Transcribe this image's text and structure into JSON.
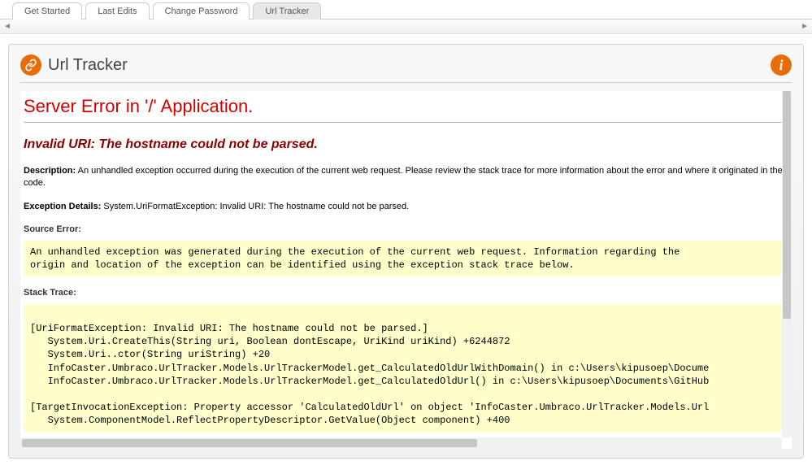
{
  "tabs": {
    "items": [
      {
        "label": "Get Started",
        "active": false
      },
      {
        "label": "Last Edits",
        "active": false
      },
      {
        "label": "Change Password",
        "active": false
      },
      {
        "label": "Url Tracker",
        "active": true
      }
    ]
  },
  "panel": {
    "title": "Url Tracker",
    "icon": "link-icon",
    "info_icon": "info-icon"
  },
  "error": {
    "title": "Server Error in '/' Application.",
    "subtitle": "Invalid URI: The hostname could not be parsed.",
    "description_label": "Description:",
    "description_text": " An unhandled exception occurred during the execution of the current web request. Please review the stack trace for more information about the error and where it originated in the code.",
    "details_label": "Exception Details:",
    "details_text": " System.UriFormatException: Invalid URI: The hostname could not be parsed.",
    "source_error_label": "Source Error:",
    "source_error_block": "An unhandled exception was generated during the execution of the current web request. Information regarding the\norigin and location of the exception can be identified using the exception stack trace below.",
    "stack_trace_label": "Stack Trace:",
    "stack_trace_block": "\n[UriFormatException: Invalid URI: The hostname could not be parsed.]\n   System.Uri.CreateThis(String uri, Boolean dontEscape, UriKind uriKind) +6244872\n   System.Uri..ctor(String uriString) +20\n   InfoCaster.Umbraco.UrlTracker.Models.UrlTrackerModel.get_CalculatedOldUrlWithDomain() in c:\\Users\\kipusoep\\Docume\n   InfoCaster.Umbraco.UrlTracker.Models.UrlTrackerModel.get_CalculatedOldUrl() in c:\\Users\\kipusoep\\Documents\\GitHub\n\n[TargetInvocationException: Property accessor 'CalculatedOldUrl' on object 'InfoCaster.Umbraco.UrlTracker.Models.Url\n   System.ComponentModel.ReflectPropertyDescriptor.GetValue(Object component) +400"
  },
  "scroll_arrows": {
    "left": "◄",
    "right": "►"
  }
}
